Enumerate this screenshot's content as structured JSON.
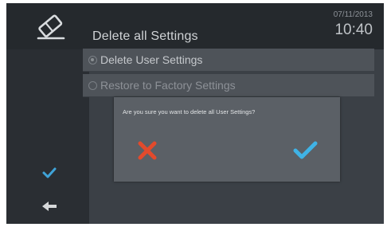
{
  "header": {
    "title": "Delete all Settings",
    "date": "07/11/2013",
    "time": "10:40",
    "logo_icon": "eraser-icon"
  },
  "sidebar": {
    "confirm_icon": "checkmark-icon",
    "back_icon": "back-arrow-icon"
  },
  "options": [
    {
      "label": "Delete User Settings",
      "selected": true
    },
    {
      "label": "Restore to Factory Settings",
      "selected": false
    }
  ],
  "dialog": {
    "message": "Are you sure you want to delete all User Settings?",
    "cancel_icon": "red-x-icon",
    "confirm_icon": "blue-check-icon"
  },
  "colors": {
    "cancel": "#e24a2c",
    "confirm": "#3fb3e6",
    "sidebar_check": "#3fa3d8"
  }
}
